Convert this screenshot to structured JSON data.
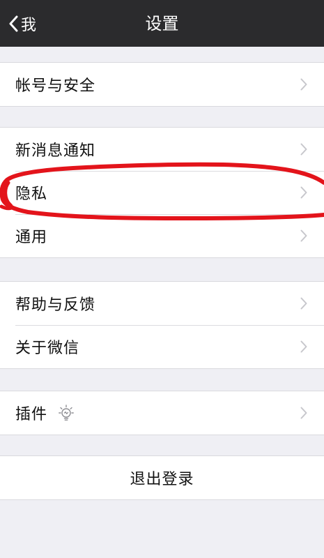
{
  "nav": {
    "back_label": "我",
    "title": "设置"
  },
  "groups": [
    {
      "items": [
        {
          "label": "帐号与安全"
        }
      ]
    },
    {
      "items": [
        {
          "label": "新消息通知"
        },
        {
          "label": "隐私"
        },
        {
          "label": "通用"
        }
      ]
    },
    {
      "items": [
        {
          "label": "帮助与反馈"
        },
        {
          "label": "关于微信"
        }
      ]
    },
    {
      "items": [
        {
          "label": "插件",
          "icon": "lightbulb-icon"
        }
      ]
    }
  ],
  "logout": {
    "label": "退出登录"
  },
  "colors": {
    "nav_background": "#2b2b2d",
    "page_background": "#efeff4",
    "annotation_stroke": "#e3141b"
  }
}
